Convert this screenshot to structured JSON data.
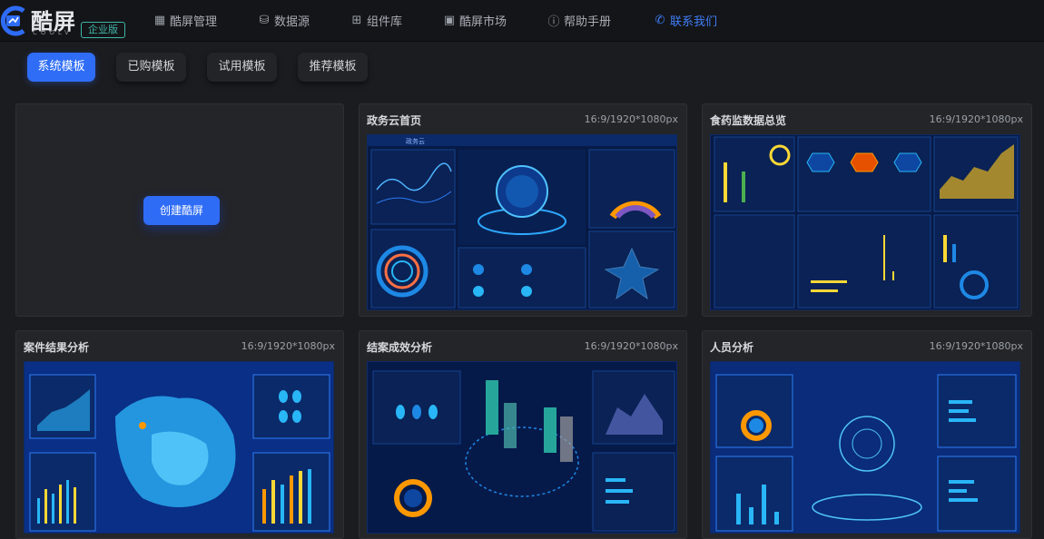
{
  "brand": {
    "title": "酷屏",
    "subtitle": "COOLV",
    "edition": "企业版"
  },
  "nav": [
    {
      "label": "酷屏管理",
      "icon": "grid-icon"
    },
    {
      "label": "数据源",
      "icon": "database-icon"
    },
    {
      "label": "组件库",
      "icon": "components-icon"
    },
    {
      "label": "酷屏市场",
      "icon": "market-icon"
    },
    {
      "label": "帮助手册",
      "icon": "help-icon"
    },
    {
      "label": "联系我们",
      "icon": "phone-icon"
    }
  ],
  "tabs": [
    {
      "label": "系统模板",
      "active": true
    },
    {
      "label": "已购模板",
      "active": false
    },
    {
      "label": "试用模板",
      "active": false
    },
    {
      "label": "推荐模板",
      "active": false
    }
  ],
  "create_button": "创建酷屏",
  "templates": [
    {
      "title": "政务云首页",
      "size": "16:9/1920*1080px"
    },
    {
      "title": "食药监数据总览",
      "size": "16:9/1920*1080px"
    },
    {
      "title": "案件结果分析",
      "size": "16:9/1920*1080px"
    },
    {
      "title": "结案成效分析",
      "size": "16:9/1920*1080px"
    },
    {
      "title": "人员分析",
      "size": "16:9/1920*1080px"
    }
  ],
  "thumb_texts": {
    "gov_header": "政务云"
  },
  "colors": {
    "accent": "#2f6df6",
    "contact": "#3f7df6",
    "edition": "#3fb5a8",
    "background": "#1b1c1f"
  }
}
